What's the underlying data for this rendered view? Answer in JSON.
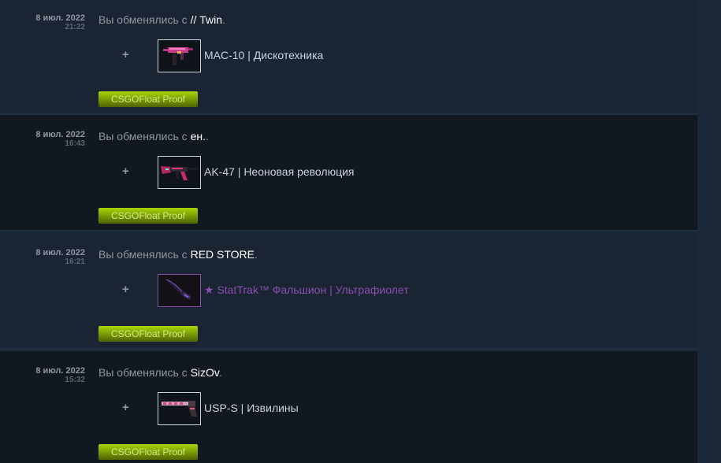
{
  "trades": [
    {
      "date": "8 июл. 2022",
      "time": "21:22",
      "description_prefix": "Вы обменялись с ",
      "partner": "// Twin",
      "description_suffix": ".",
      "plus": "+",
      "item_name": "MAC-10 | Дискотехника",
      "item_icon": "mac10-weapon-icon",
      "button_label": "CSGOFloat Proof"
    },
    {
      "date": "8 июл. 2022",
      "time": "16:43",
      "description_prefix": "Вы обменялись с ",
      "partner": "ен.",
      "description_suffix": ".",
      "plus": "+",
      "item_name": "AK-47 | Неоновая революция",
      "item_icon": "ak47-weapon-icon",
      "button_label": "CSGOFloat Proof"
    },
    {
      "date": "8 июл. 2022",
      "time": "16:21",
      "description_prefix": "Вы обменялись с ",
      "partner": "RED STORE",
      "description_suffix": ".",
      "plus": "+",
      "item_name": "★ StatTrak™ Фальшион | Ультрафиолет",
      "item_icon": "falchion-knife-icon",
      "button_label": "CSGOFloat Proof"
    },
    {
      "date": "8 июл. 2022",
      "time": "15:32",
      "description_prefix": "Вы обменялись с ",
      "partner": "SizOv",
      "description_suffix": ".",
      "plus": "+",
      "item_name": "USP-S | Извилины",
      "item_icon": "usps-weapon-icon",
      "button_label": "CSGOFloat Proof"
    }
  ],
  "colors": {
    "background": "#1b2838",
    "row_light": "#1b2433",
    "row_dark": "#111820",
    "text_muted": "#8f98a0",
    "text_item": "#c6d4df",
    "covert_purple": "#8650ac",
    "button_green": "#a4d007"
  }
}
